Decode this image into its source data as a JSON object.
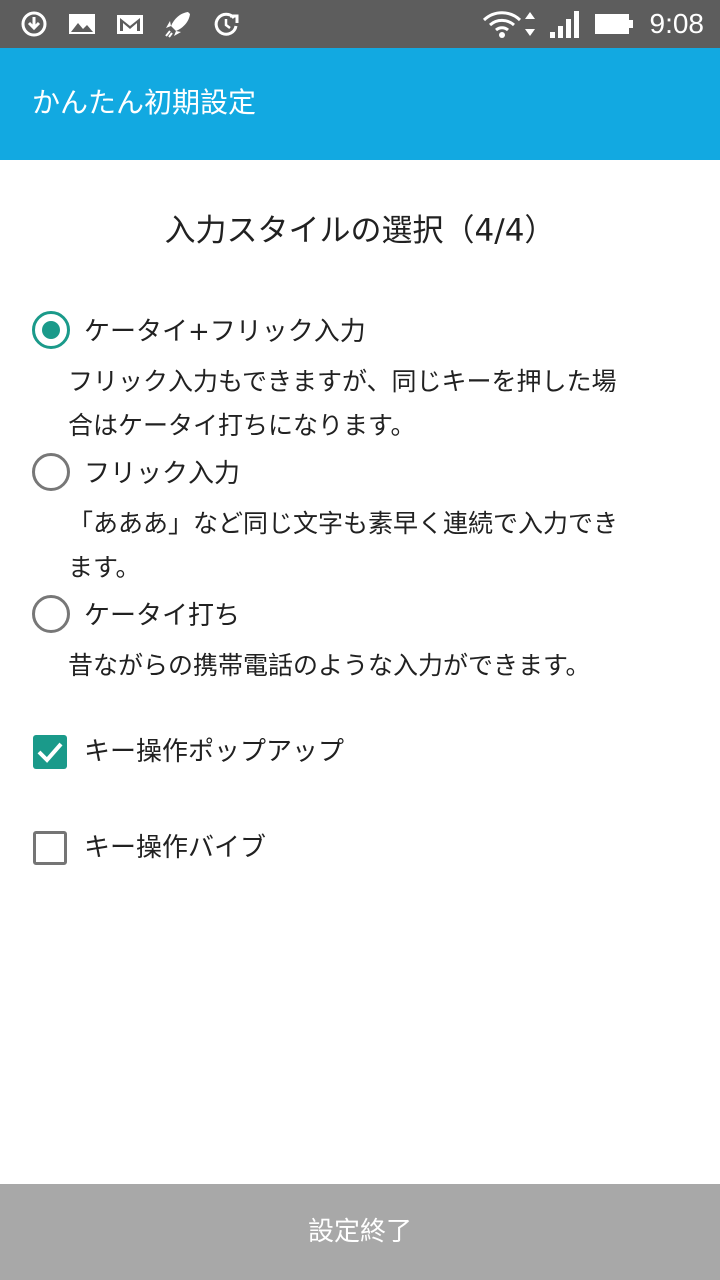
{
  "status_bar": {
    "time": "9:08",
    "icons": [
      "download-icon",
      "image-icon",
      "gmail-icon",
      "rocket-icon",
      "sync-icon",
      "wifi-icon",
      "data-arrows-icon",
      "signal-icon",
      "battery-icon"
    ]
  },
  "app_bar": {
    "title": "かんたん初期設定"
  },
  "page": {
    "title": "入力スタイルの選択（4/4）"
  },
  "options": [
    {
      "label": "ケータイ+フリック入力",
      "desc_line1": "フリック入力もできますが、同じキーを押した場",
      "desc_line2": "合はケータイ打ちになります。",
      "selected": true
    },
    {
      "label": "フリック入力",
      "desc_line1": "「あああ」など同じ文字も素早く連続で入力でき",
      "desc_line2": "ます。",
      "selected": false
    },
    {
      "label": "ケータイ打ち",
      "desc_line1": "昔ながらの携帯電話のような入力ができます。",
      "selected": false
    }
  ],
  "checkboxes": [
    {
      "label": "キー操作ポップアップ",
      "checked": true
    },
    {
      "label": "キー操作バイブ",
      "checked": false
    }
  ],
  "footer": {
    "finish_label": "設定終了"
  },
  "colors": {
    "status_bar": "#5d5d5d",
    "app_bar": "#12a9e1",
    "accent": "#1a9a8a",
    "footer_button": "#a8a8a8"
  }
}
